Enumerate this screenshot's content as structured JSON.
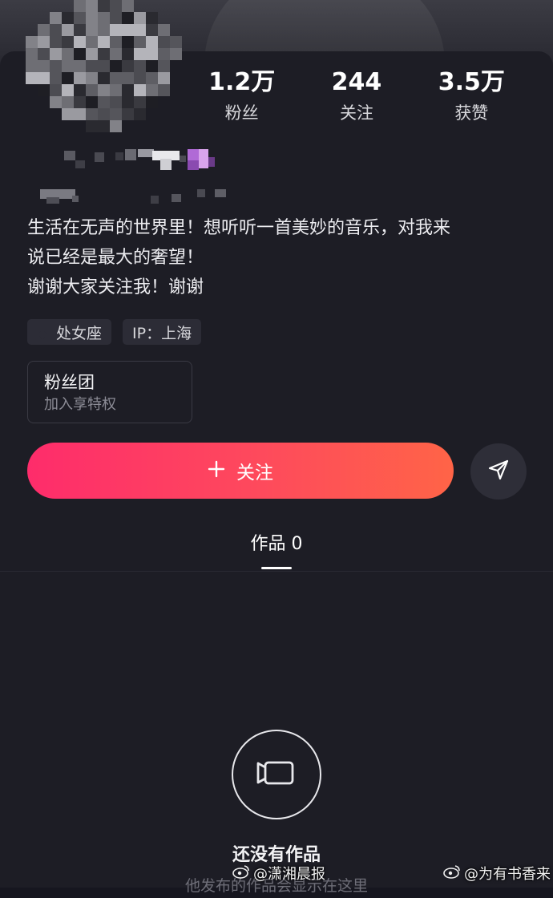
{
  "profile": {
    "stats": [
      {
        "value": "1.2万",
        "label": "粉丝"
      },
      {
        "value": "244",
        "label": "关注"
      },
      {
        "value": "3.5万",
        "label": "获赞"
      }
    ],
    "bio_lines": [
      "生活在无声的世界里！想听听一首美妙的音乐，对我来",
      "说已经是最大的奢望！",
      "谢谢大家关注我！谢谢"
    ],
    "tags": [
      {
        "label": "处女座",
        "icon": "zodiac-icon"
      },
      {
        "label": "IP：上海",
        "icon": ""
      }
    ]
  },
  "fan_club": {
    "title": "粉丝团",
    "subtitle": "加入享特权"
  },
  "actions": {
    "follow_label": "关注",
    "follow_icon": "plus-icon",
    "share_icon": "send-icon"
  },
  "tabs": {
    "works_label": "作品 0"
  },
  "empty_state": {
    "icon": "video-camera-icon",
    "title": "还没有作品",
    "subtitle": "他发布的作品会显示在这里"
  },
  "watermarks": {
    "left": "@潇湘晨报",
    "right": "@为有书香来"
  },
  "colors": {
    "background": "#1d1d25",
    "follow_gradient_start": "#fe2c6b",
    "follow_gradient_end": "#ff6447"
  }
}
